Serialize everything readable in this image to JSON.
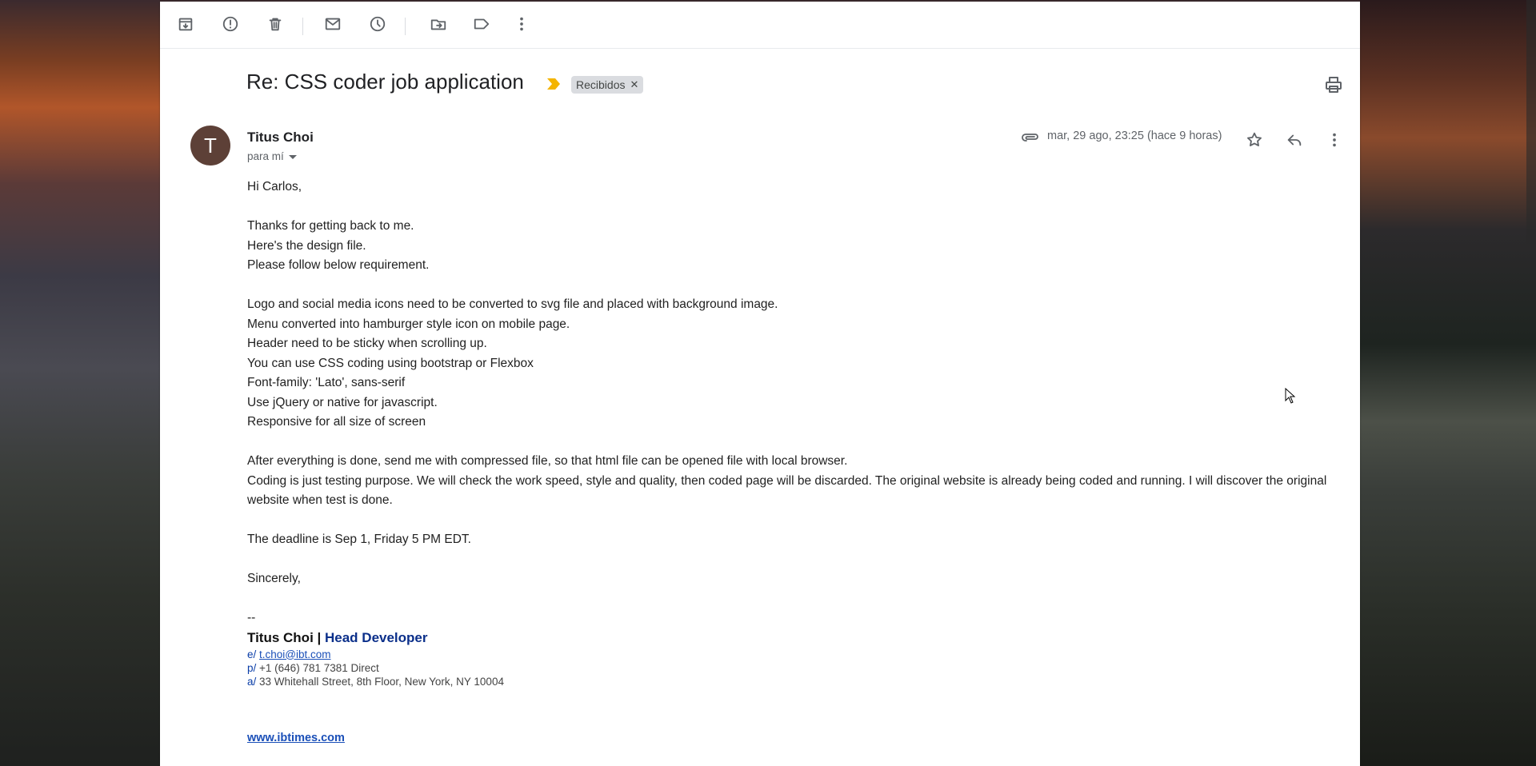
{
  "subject": "Re: CSS coder job application",
  "label": "Recibidos",
  "sender": {
    "initial": "T",
    "name": "Titus Choi",
    "to": "para mí",
    "date": "mar, 29 ago, 23:25 (hace 9 horas)"
  },
  "body_lines": {
    "l1": "Hi Carlos,",
    "l2": "Thanks for getting back to me.",
    "l3": "Here's the design file.",
    "l4": "Please follow below requirement.",
    "l5": "Logo and social media icons need to be converted to svg file and placed with background image.",
    "l6": "Menu converted into hamburger style icon on mobile page.",
    "l7": "Header need to be sticky when scrolling up.",
    "l8": "You can use CSS coding using bootstrap or Flexbox",
    "l9": "Font-family: 'Lato', sans-serif",
    "l10": "Use jQuery or native for javascript.",
    "l11": "Responsive for all size of screen",
    "l12": "After everything is done, send me with compressed file, so that html file can be opened file with local browser.",
    "l13": "Coding is just testing purpose. We will check the work speed, style and quality, then coded page will be discarded. The original website is already being coded and running. I will discover the original website when test is done.",
    "l14": "The deadline is Sep 1, Friday 5 PM EDT.",
    "l15": "Sincerely,"
  },
  "signature": {
    "dash": "--",
    "name": "Titus Choi | ",
    "role": "Head Developer",
    "email_key": "e/",
    "email": "t.choi@ibt.com",
    "phone_key": "p/",
    "phone": "+1 (646) 781 7381 Direct",
    "address_key": "a/",
    "address": "33 Whitehall Street, 8th Floor, New York, NY 10004",
    "website": "www.ibtimes.com"
  },
  "colors": {
    "avatar": "#5d4037",
    "importance": "#f4b400",
    "signature_role": "#0b2f8a"
  },
  "icons": {
    "toolbar": [
      "archive-icon",
      "report-spam-icon",
      "delete-icon",
      "mark-unread-icon",
      "snooze-icon",
      "move-to-icon",
      "label-icon",
      "more-vert-icon"
    ],
    "message": [
      "attachment-icon",
      "star-icon",
      "reply-icon",
      "more-vert-icon"
    ]
  }
}
